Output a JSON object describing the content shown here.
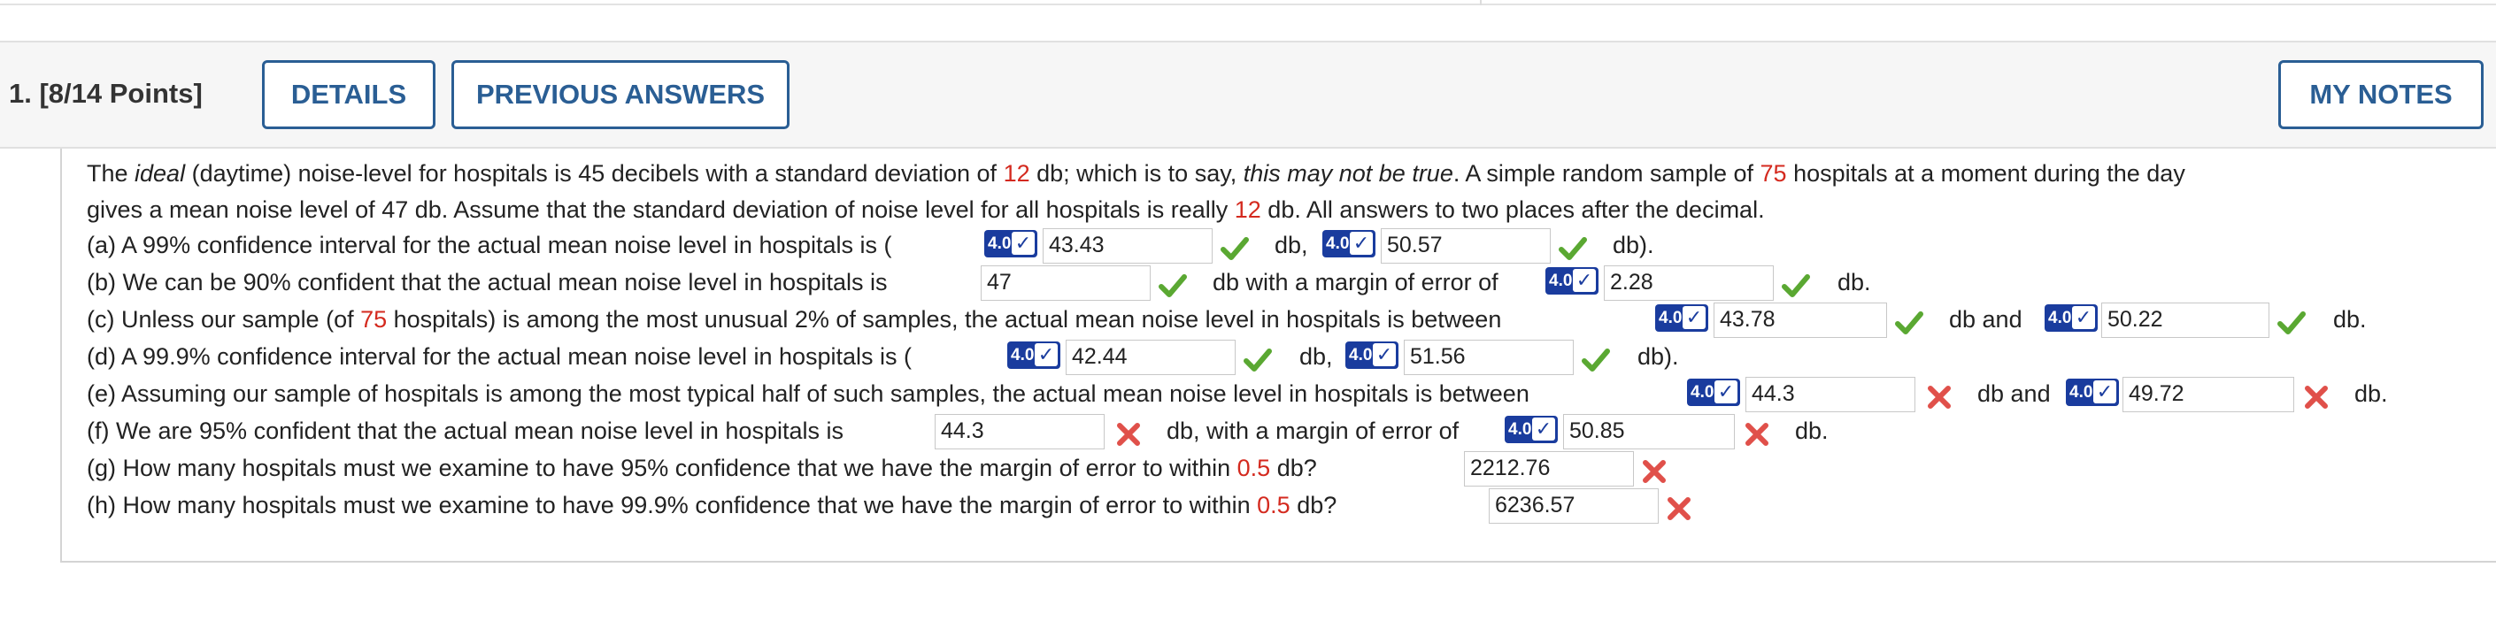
{
  "question": {
    "number_label": "1. [8/14 Points]",
    "details_label": "DETAILS",
    "previous_answers_label": "PREVIOUS ANSWERS",
    "my_notes_label": "MY NOTES"
  },
  "intro": {
    "t1": "The ",
    "t2": "ideal",
    "t3": " (daytime) noise-level for hospitals is 45 decibels with a standard deviation of ",
    "sd": "12",
    "t4": " db; which is to say, ",
    "t5": "this may not be true",
    "t6": ". A simple random sample of ",
    "n": "75",
    "t7": " hospitals at a moment during the day",
    "line2a": "gives a mean noise level of 47 db. Assume that the standard deviation of noise level for all hospitals is really ",
    "sd2": "12",
    "line2b": " db. All answers to two places after the decimal."
  },
  "badge_label": "4.0",
  "badge_check": "✓",
  "parts": {
    "a": {
      "text": "(a) A 99% confidence interval for the actual mean noise level in hospitals is (",
      "val1": "43.43",
      "mid": "db,",
      "val2": "50.57",
      "end": "db)."
    },
    "b": {
      "text": "(b) We can be 90% confident that the actual mean noise level in hospitals is",
      "val1": "47",
      "mid": "db with a margin of error of",
      "val2": "2.28",
      "end": "db."
    },
    "c": {
      "text_a": "(c) Unless our sample (of ",
      "n": "75",
      "text_b": " hospitals) is among the most unusual 2% of samples, the actual mean noise level in hospitals is between",
      "val1": "43.78",
      "mid": "db and",
      "val2": "50.22",
      "end": "db."
    },
    "d": {
      "text": "(d) A 99.9% confidence interval for the actual mean noise level in hospitals is (",
      "val1": "42.44",
      "mid": "db,",
      "val2": "51.56",
      "end": "db)."
    },
    "e": {
      "text": "(e) Assuming our sample of hospitals is among the most typical half of such samples, the actual mean noise level in hospitals is between",
      "val1": "44.3",
      "mid": "db and",
      "val2": "49.72",
      "end": "db."
    },
    "f": {
      "text": "(f) We are 95% confident that the actual mean noise level in hospitals is",
      "val1": "44.3",
      "mid": "db, with a margin of error of",
      "val2": "50.85",
      "end": "db."
    },
    "g": {
      "text_a": "(g) How many hospitals must we examine to have 95% confidence that we have the margin of error to within ",
      "moe": "0.5",
      "text_b": " db?",
      "val1": "2212.76"
    },
    "h": {
      "text_a": "(h) How many hospitals must we examine to have 99.9% confidence that we have the margin of error to within ",
      "moe": "0.5",
      "text_b": " db?",
      "val1": "6236.57"
    }
  },
  "colors": {
    "correct": "#5aa832",
    "incorrect": "#e0504a",
    "accent": "#2a5e94",
    "badge": "#1a3c9e",
    "highlight": "#d42a1f"
  }
}
